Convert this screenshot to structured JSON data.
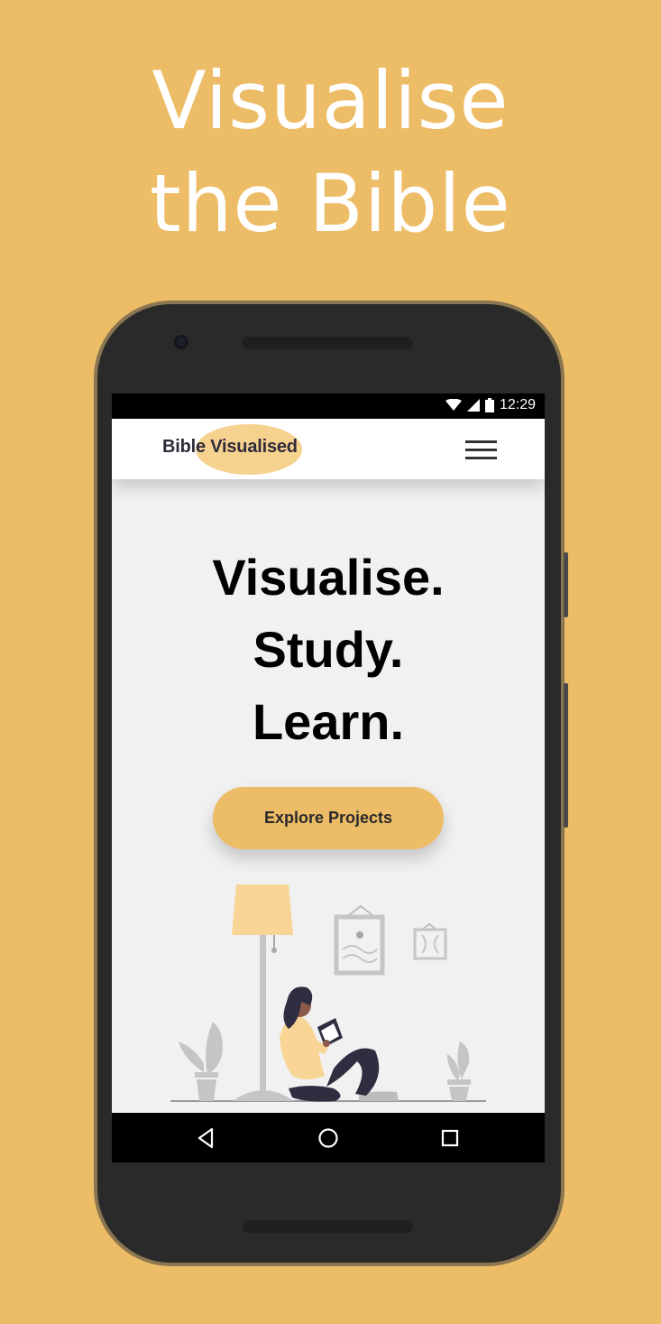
{
  "promo": {
    "line1": "Visualise",
    "line2": "the Bible"
  },
  "status_bar": {
    "time": "12:29",
    "icons": [
      "wifi-icon",
      "signal-icon",
      "battery-icon"
    ]
  },
  "header": {
    "logo_text": "Bible Visualised",
    "menu_icon": "hamburger-menu-icon"
  },
  "hero": {
    "line1": "Visualise.",
    "line2": "Study.",
    "line3": "Learn.",
    "cta_label": "Explore Projects"
  },
  "nav_bar": {
    "buttons": [
      "back-triangle-icon",
      "home-circle-icon",
      "recents-square-icon"
    ]
  },
  "colors": {
    "background": "#EDBC66",
    "accent": "#F6D28F",
    "app_bg": "#f1f1f1"
  }
}
